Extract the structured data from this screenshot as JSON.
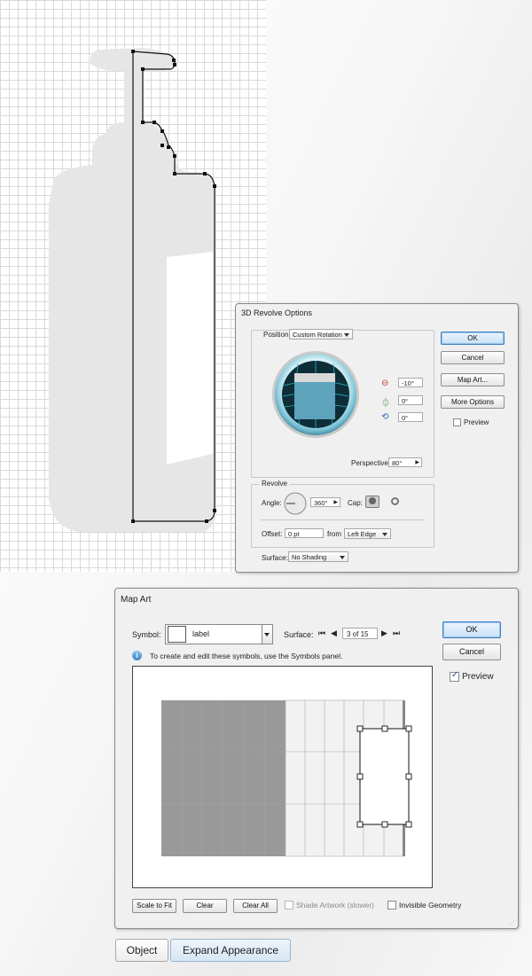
{
  "revolve_dialog": {
    "title": "3D Revolve Options",
    "position_label": "Position:",
    "position_value": "Custom Rotation",
    "x_angle": "-10°",
    "y_angle": "0°",
    "z_angle": "0°",
    "perspective_label": "Perspective:",
    "perspective_value": "80°",
    "revolve_group_label": "Revolve",
    "angle_label": "Angle:",
    "angle_value": "360°",
    "cap_label": "Cap:",
    "offset_label": "Offset:",
    "offset_value": "0 pt",
    "from_label": "from",
    "from_value": "Left Edge",
    "surface_label": "Surface:",
    "surface_value": "No Shading",
    "ok_label": "OK",
    "cancel_label": "Cancel",
    "map_art_label": "Map Art...",
    "more_options_label": "More Options",
    "preview_label": "Preview",
    "preview_checked": false
  },
  "map_art_dialog": {
    "title": "Map Art",
    "symbol_label": "Symbol:",
    "symbol_value": "label",
    "surface_label": "Surface:",
    "surface_value": "3 of 15",
    "info_text": "To create and edit these symbols, use the Symbols panel.",
    "ok_label": "OK",
    "cancel_label": "Cancel",
    "preview_label": "Preview",
    "preview_checked": true,
    "scale_to_fit_label": "Scale to Fit",
    "clear_label": "Clear",
    "clear_all_label": "Clear All",
    "shade_artwork_label": "Shade Artwork (slower)",
    "invisible_geometry_label": "Invisible Geometry"
  },
  "bottom_bar": {
    "object_label": "Object",
    "expand_appearance_label": "Expand Appearance"
  },
  "colors": {
    "accent": "#3d7fc4",
    "bottle_fill": "#e6e6e6",
    "preview_cube": "#5ca3bb",
    "map_art_label_fill": "#999999"
  }
}
